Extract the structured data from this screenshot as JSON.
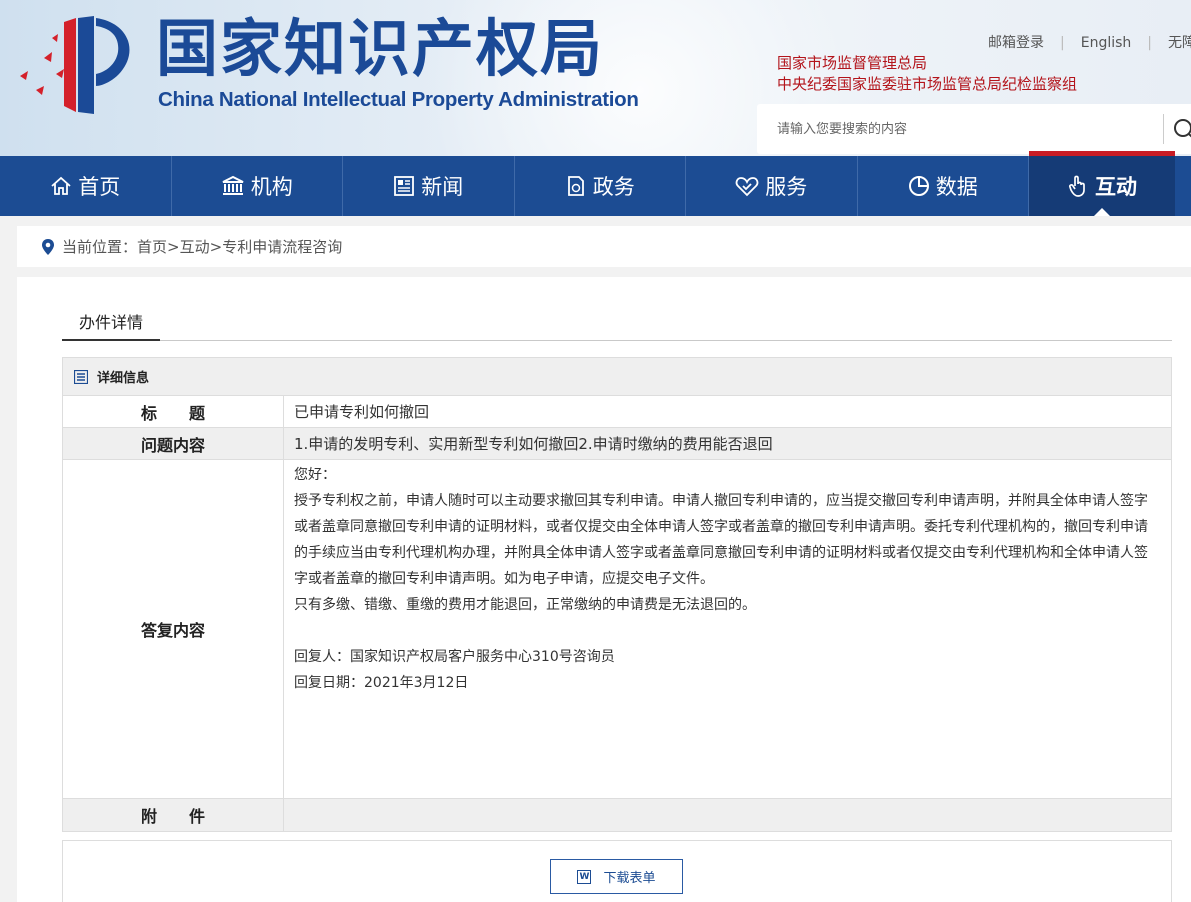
{
  "header": {
    "logo_cn": "国家知识产权局",
    "logo_en": "China National Intellectual Property Administration",
    "top_links": [
      "邮箱登录",
      "English",
      "无障"
    ],
    "gov_links": [
      "国家市场监督管理总局",
      "中央纪委国家监委驻市场监管总局纪检监察组"
    ],
    "search_placeholder": "请输入您要搜索的内容"
  },
  "nav": {
    "items": [
      {
        "label": "首页",
        "icon": "home-icon"
      },
      {
        "label": "机构",
        "icon": "institution-icon"
      },
      {
        "label": "新闻",
        "icon": "news-icon"
      },
      {
        "label": "政务",
        "icon": "government-icon"
      },
      {
        "label": "服务",
        "icon": "service-icon"
      },
      {
        "label": "数据",
        "icon": "data-icon"
      },
      {
        "label": "互动",
        "icon": "interaction-icon",
        "active": true
      }
    ]
  },
  "breadcrumb": {
    "prefix": "当前位置：",
    "items": [
      "首页",
      ">",
      "互动",
      ">",
      "专利申请流程咨询"
    ]
  },
  "panel": {
    "tab": "办件详情",
    "detail_title": "详细信息",
    "rows": {
      "title_label": "标　　题",
      "title_value": "已申请专利如何撤回",
      "question_label": "问题内容",
      "question_value": "1.申请的发明专利、实用新型专利如何撤回2.申请时缴纳的费用能否退回",
      "answer_label": "答复内容",
      "answer_lines": [
        "您好：",
        "授予专利权之前，申请人随时可以主动要求撤回其专利申请。申请人撤回专利申请的，应当提交撤回专利申请声明，并附具全体申请人签字或者盖章同意撤回专利申请的证明材料，或者仅提交由全体申请人签字或者盖章的撤回专利申请声明。委托专利代理机构的，撤回专利申请的手续应当由专利代理机构办理，并附具全体申请人签字或者盖章同意撤回专利申请的证明材料或者仅提交由专利代理机构和全体申请人签字或者盖章的撤回专利申请声明。如为电子申请，应提交电子文件。",
        "只有多缴、错缴、重缴的费用才能退回，正常缴纳的申请费是无法退回的。",
        "",
        "回复人：国家知识产权局客户服务中心310号咨询员",
        "回复日期：2021年3月12日"
      ],
      "attachment_label": "附　　件",
      "attachment_value": ""
    },
    "download_label": "下载表单"
  },
  "colors": {
    "brand": "#1c4c93",
    "accent": "#c81c25",
    "gov_text": "#b3141b"
  }
}
